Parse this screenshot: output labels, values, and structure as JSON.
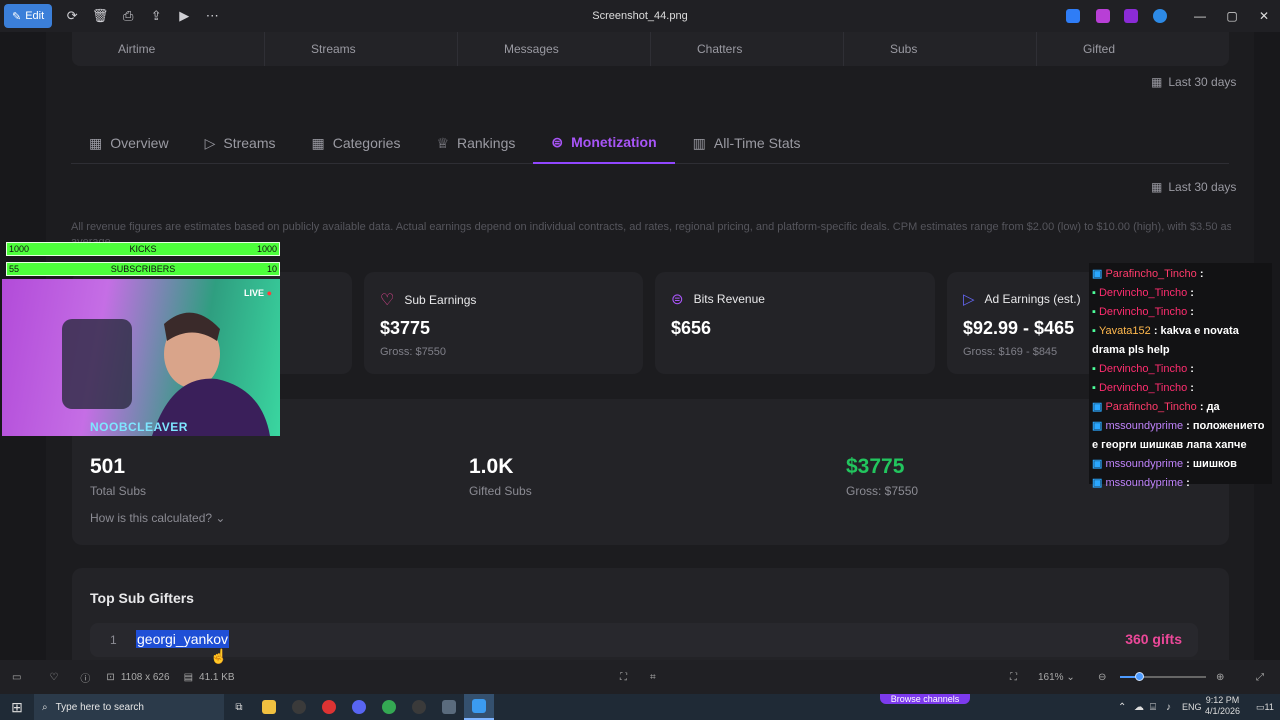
{
  "viewer": {
    "edit_label": "Edit",
    "title": "Screenshot_44.png",
    "dimensions": "1108 x 626",
    "filesize": "41.1 KB",
    "zoom": "161%",
    "icons": [
      "rotate-icon",
      "trash-icon",
      "print-icon",
      "share-icon",
      "slideshow-icon",
      "more-icon"
    ]
  },
  "top_stats": [
    "Airtime",
    "Streams",
    "Messages",
    "Chatters",
    "Subs",
    "Gifted"
  ],
  "period_label": "Last 30 days",
  "tabs": [
    {
      "label": "Overview",
      "icon": "grid-icon"
    },
    {
      "label": "Streams",
      "icon": "play-icon"
    },
    {
      "label": "Categories",
      "icon": "grid-icon"
    },
    {
      "label": "Rankings",
      "icon": "trophy-icon"
    },
    {
      "label": "Monetization",
      "icon": "dollar-icon",
      "active": true
    },
    {
      "label": "All-Time Stats",
      "icon": "bar-chart-icon"
    }
  ],
  "disclaimer": "All revenue figures are estimates based on publicly available data. Actual earnings depend on individual contracts, ad rates, regional pricing, and platform-specific deals. CPM estimates range from $2.00 (low) to $10.00 (high), with $3.50 as a typical",
  "disclaimer_2": "average.",
  "cards": [
    {
      "title": "Sub Earnings",
      "value": "$3775",
      "gross": "Gross: $7550",
      "color": "#ec4899"
    },
    {
      "title": "Bits Revenue",
      "value": "$656",
      "gross": "",
      "color": "#a855f7"
    },
    {
      "title": "Ad Earnings (est.)",
      "value": "$92.99 - $465",
      "gross": "Gross: $169 - $845",
      "color": "#6366f1"
    }
  ],
  "subs": {
    "total": "501",
    "total_label": "Total Subs",
    "gifted": "1.0K",
    "gifted_label": "Gifted Subs",
    "earnings": "$3775",
    "earnings_gross": "Gross: $7550",
    "calc_link": "How is this calculated?"
  },
  "gifters": {
    "title": "Top Sub Gifters",
    "rows": [
      {
        "rank": "1",
        "name": "georgi_yankov",
        "gifts": "360 gifts"
      }
    ]
  },
  "overlay": {
    "kicks_label": "KICKS",
    "kicks_left": "1000",
    "kicks_right": "1000",
    "subs_label": "SUBSCRIBERS",
    "subs_left": "55",
    "subs_right": "10",
    "live": "LIVE",
    "streamer": "NOOBCLEAVER"
  },
  "chat": [
    {
      "user": "Parafincho_Tincho",
      "color": "#ff3b6b",
      "msg": ":"
    },
    {
      "user": "Dervincho_Tincho",
      "color": "#ff2d6f",
      "msg": ":"
    },
    {
      "user": "Dervincho_Tincho",
      "color": "#ff2d6f",
      "msg": ":"
    },
    {
      "user": "Yavata152",
      "color": "#ffb84d",
      "msg": ": kakva e novata drama pls help"
    },
    {
      "user": "Dervincho_Tincho",
      "color": "#ff2d6f",
      "msg": ":"
    },
    {
      "user": "Dervincho_Tincho",
      "color": "#ff2d6f",
      "msg": ":"
    },
    {
      "user": "Parafincho_Tincho",
      "color": "#ff3b6b",
      "msg": ": да"
    },
    {
      "user": "mssoundyprime",
      "color": "#c084fc",
      "msg": ": положението е георги шишкав лапа хапче"
    },
    {
      "user": "mssoundyprime",
      "color": "#c084fc",
      "msg": ": шишков"
    },
    {
      "user": "mssoundyprime",
      "color": "#c084fc",
      "msg": ":"
    }
  ],
  "taskbar": {
    "search_placeholder": "Type here to search",
    "browse_channels": "Browse channels",
    "lang": "ENG",
    "time": "9:12 PM",
    "date": "4/1/2026",
    "notif_count": "11"
  }
}
